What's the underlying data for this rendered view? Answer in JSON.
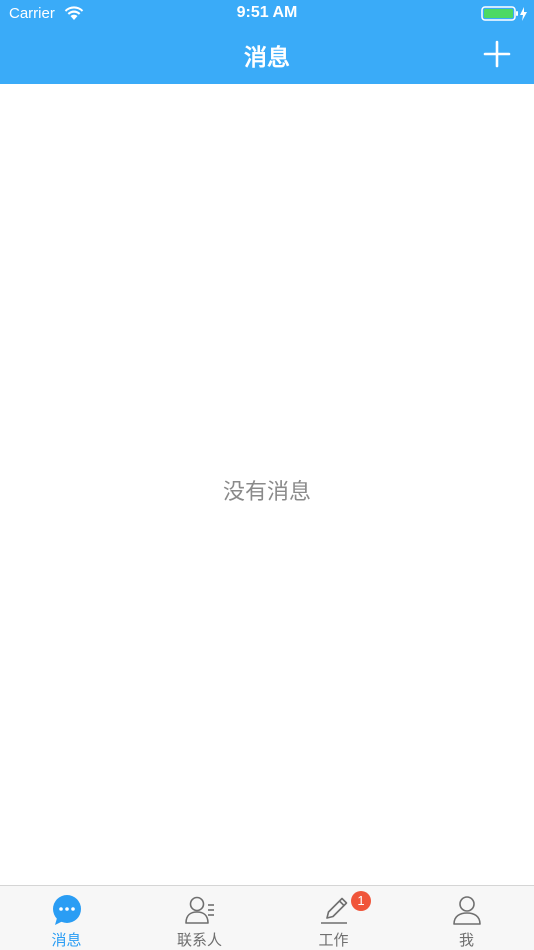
{
  "status_bar": {
    "carrier": "Carrier",
    "time": "9:51 AM"
  },
  "nav": {
    "title": "消息",
    "add_icon": "plus-icon"
  },
  "content": {
    "empty_text": "没有消息"
  },
  "tab_bar": {
    "active_color": "#2a9df4",
    "inactive_color": "#6f6f6f",
    "tabs": [
      {
        "label": "消息",
        "icon": "chat-bubble-icon",
        "active": true
      },
      {
        "label": "联系人",
        "icon": "contacts-icon",
        "active": false
      },
      {
        "label": "工作",
        "icon": "pen-icon",
        "active": false,
        "badge": "1"
      },
      {
        "label": "我",
        "icon": "person-icon",
        "active": false
      }
    ]
  },
  "colors": {
    "header_bg": "#3aabf8",
    "badge_bg": "#f0553a"
  }
}
